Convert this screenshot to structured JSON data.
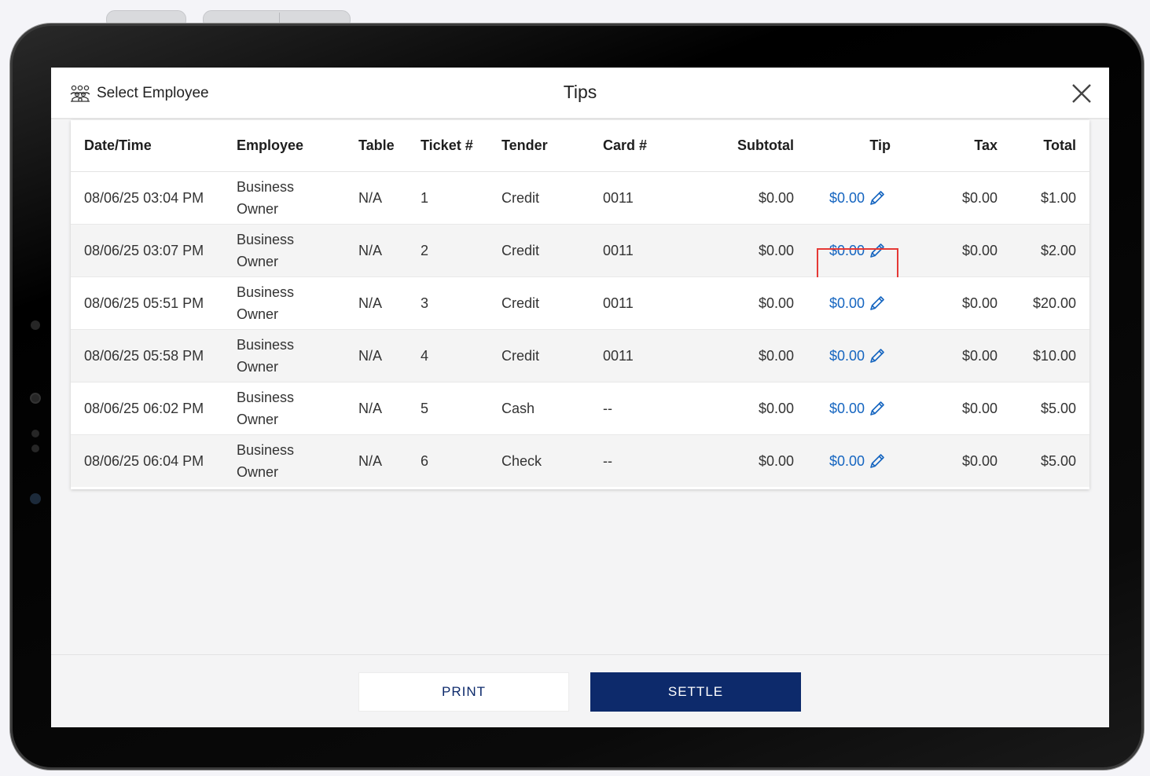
{
  "header": {
    "select_employee_label": "Select Employee",
    "title": "Tips"
  },
  "table": {
    "columns": [
      "Date/Time",
      "Employee",
      "Table",
      "Ticket #",
      "Tender",
      "Card #",
      "Subtotal",
      "Tip",
      "Tax",
      "Total"
    ],
    "rows": [
      {
        "datetime": "08/06/25 03:04 PM",
        "employee_line1": "Business",
        "employee_line2": "Owner",
        "table": "N/A",
        "ticket": "1",
        "tender": "Credit",
        "card": "0011",
        "subtotal": "$0.00",
        "tip": "$0.00",
        "tax": "$0.00",
        "total": "$1.00"
      },
      {
        "datetime": "08/06/25 03:07 PM",
        "employee_line1": "Business",
        "employee_line2": "Owner",
        "table": "N/A",
        "ticket": "2",
        "tender": "Credit",
        "card": "0011",
        "subtotal": "$0.00",
        "tip": "$0.00",
        "tax": "$0.00",
        "total": "$2.00"
      },
      {
        "datetime": "08/06/25 05:51 PM",
        "employee_line1": "Business",
        "employee_line2": "Owner",
        "table": "N/A",
        "ticket": "3",
        "tender": "Credit",
        "card": "0011",
        "subtotal": "$0.00",
        "tip": "$0.00",
        "tax": "$0.00",
        "total": "$20.00"
      },
      {
        "datetime": "08/06/25 05:58 PM",
        "employee_line1": "Business",
        "employee_line2": "Owner",
        "table": "N/A",
        "ticket": "4",
        "tender": "Credit",
        "card": "0011",
        "subtotal": "$0.00",
        "tip": "$0.00",
        "tax": "$0.00",
        "total": "$10.00"
      },
      {
        "datetime": "08/06/25 06:02 PM",
        "employee_line1": "Business",
        "employee_line2": "Owner",
        "table": "N/A",
        "ticket": "5",
        "tender": "Cash",
        "card": "--",
        "subtotal": "$0.00",
        "tip": "$0.00",
        "tax": "$0.00",
        "total": "$5.00"
      },
      {
        "datetime": "08/06/25 06:04 PM",
        "employee_line1": "Business",
        "employee_line2": "Owner",
        "table": "N/A",
        "ticket": "6",
        "tender": "Check",
        "card": "--",
        "subtotal": "$0.00",
        "tip": "$0.00",
        "tax": "$0.00",
        "total": "$5.00"
      }
    ]
  },
  "footer": {
    "print_label": "PRINT",
    "settle_label": "SETTLE"
  },
  "icons": {
    "employees": "people-group-icon",
    "close": "close-icon",
    "edit": "pencil-icon"
  },
  "colors": {
    "tip_link": "#1565c0",
    "settle_bg": "#0d2a6b",
    "highlight": "#e53935"
  }
}
